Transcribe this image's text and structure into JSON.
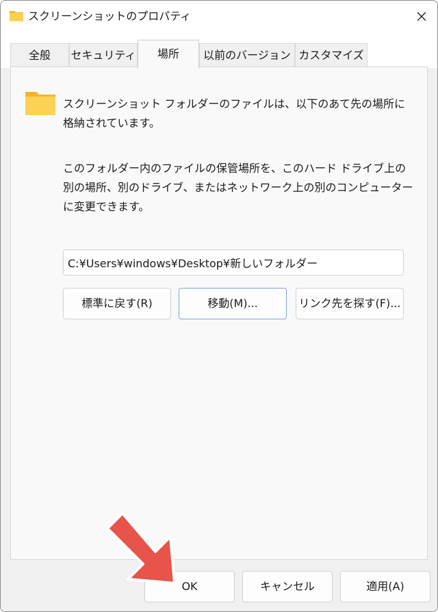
{
  "window": {
    "title": "スクリーンショットのプロパティ",
    "close_glyph": "✕"
  },
  "tabs": [
    {
      "label": "全般",
      "active": false
    },
    {
      "label": "セキュリティ",
      "active": false
    },
    {
      "label": "場所",
      "active": true
    },
    {
      "label": "以前のバージョン",
      "active": false
    },
    {
      "label": "カスタマイズ",
      "active": false
    }
  ],
  "location": {
    "info_text": "スクリーンショット フォルダーのファイルは、以下のあて先の場所に格納されています。",
    "description_text": "このフォルダー内のファイルの保管場所を、このハード ドライブ上の別の場所、別のドライブ、またはネットワーク上の別のコンピューターに変更できます。",
    "path_value": "C:¥Users¥windows¥Desktop¥新しいフォルダー",
    "restore_default_label": "標準に戻す(R)",
    "move_label": "移動(M)...",
    "find_target_label": "リンク先を探す(F)..."
  },
  "footer": {
    "ok_label": "OK",
    "cancel_label": "キャンセル",
    "apply_label": "適用(A)"
  },
  "colors": {
    "folder_yellow": "#f8c93e",
    "callout_arrow": "#e8534a"
  }
}
